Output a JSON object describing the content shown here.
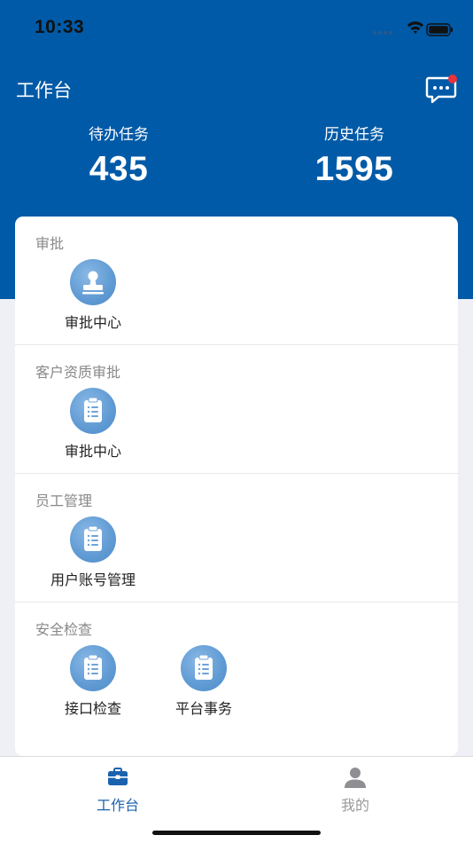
{
  "status_bar": {
    "time": "10:33"
  },
  "header": {
    "title": "工作台",
    "message_icon": "chat-bubble-icon",
    "has_unread": true,
    "background_color": "#005aa7"
  },
  "stats": {
    "pending": {
      "label": "待办任务",
      "value": "435"
    },
    "history": {
      "label": "历史任务",
      "value": "1595"
    }
  },
  "sections": [
    {
      "title": "审批",
      "items": [
        {
          "label": "审批中心",
          "icon": "stamp-icon"
        }
      ]
    },
    {
      "title": "客户资质审批",
      "items": [
        {
          "label": "审批中心",
          "icon": "clipboard-icon"
        }
      ]
    },
    {
      "title": "员工管理",
      "items": [
        {
          "label": "用户账号管理",
          "icon": "clipboard-icon"
        }
      ]
    },
    {
      "title": "安全检查",
      "items": [
        {
          "label": "接口检查",
          "icon": "clipboard-icon"
        },
        {
          "label": "平台事务",
          "icon": "clipboard-icon"
        }
      ]
    }
  ],
  "tab_bar": {
    "tabs": [
      {
        "label": "工作台",
        "icon": "briefcase-icon",
        "active": true
      },
      {
        "label": "我的",
        "icon": "person-icon",
        "active": false
      }
    ],
    "active_color": "#1a62ad",
    "inactive_color": "#999999"
  }
}
